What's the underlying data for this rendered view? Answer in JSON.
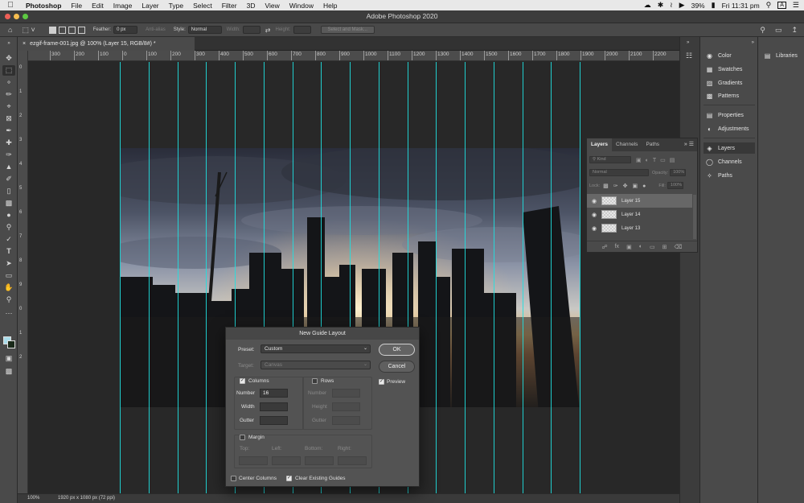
{
  "menubar": {
    "app_name": "Photoshop",
    "menus": [
      "File",
      "Edit",
      "Image",
      "Layer",
      "Type",
      "Select",
      "Filter",
      "3D",
      "View",
      "Window",
      "Help"
    ],
    "battery": "39%",
    "clock": "Fri 11:31 pm",
    "input_source": "A"
  },
  "window": {
    "title": "Adobe Photoshop 2020"
  },
  "options": {
    "feather_label": "Feather:",
    "feather_value": "0 px",
    "anti_alias": "Anti-alias",
    "style_label": "Style:",
    "style_value": "Normal",
    "width_label": "Width:",
    "height_label": "Height:",
    "select_mask": "Select and Mask..."
  },
  "document": {
    "tab_title": "ezgif-frame-001.jpg @ 100% (Layer 15, RGB/8#) *",
    "zoom": "100%",
    "dimensions": "1920 px x 1080 px (72 ppi)"
  },
  "ruler": {
    "h_labels": [
      "300",
      "200",
      "100",
      "0",
      "100",
      "200",
      "300",
      "400",
      "500",
      "600",
      "700",
      "800",
      "900",
      "1000",
      "1100",
      "1200",
      "1300",
      "1400",
      "1500",
      "1600",
      "1700",
      "1800",
      "1900",
      "2000",
      "2100",
      "2200"
    ],
    "v_labels": [
      "0",
      "1",
      "2",
      "3",
      "4",
      "5",
      "6",
      "7",
      "8",
      "9",
      "0",
      "1",
      "2"
    ]
  },
  "guides": {
    "count": 16
  },
  "panels": {
    "dock1": [
      {
        "label": "Color",
        "icon": "color-wheel-icon"
      },
      {
        "label": "Swatches",
        "icon": "grid-icon"
      },
      {
        "label": "Gradients",
        "icon": "gradient-icon"
      },
      {
        "label": "Patterns",
        "icon": "pattern-icon"
      },
      {
        "label": "Properties",
        "icon": "properties-icon"
      },
      {
        "label": "Adjustments",
        "icon": "adjustments-icon"
      },
      {
        "label": "Layers",
        "icon": "layers-icon"
      },
      {
        "label": "Channels",
        "icon": "channels-icon"
      },
      {
        "label": "Paths",
        "icon": "paths-icon"
      }
    ],
    "dock2": [
      {
        "label": "Libraries",
        "icon": "libraries-icon"
      }
    ]
  },
  "layers_panel": {
    "tabs": [
      "Layers",
      "Channels",
      "Paths"
    ],
    "kind": "Kind",
    "blend": "Normal",
    "opacity_label": "Opacity:",
    "opacity_value": "100%",
    "lock_label": "Lock:",
    "fill_label": "Fill:",
    "fill_value": "100%",
    "layers": [
      "Layer 15",
      "Layer 14",
      "Layer 13"
    ]
  },
  "dialog": {
    "title": "New Guide Layout",
    "preset_label": "Preset:",
    "preset_value": "Custom",
    "target_label": "Target:",
    "target_value": "Canvas",
    "columns_label": "Columns",
    "columns_checked": true,
    "rows_label": "Rows",
    "rows_checked": false,
    "number_label": "Number",
    "number_value": "16",
    "width_label": "Width",
    "gutter_label": "Gutter",
    "margin_label": "Margin",
    "margin_checked": false,
    "margin_top": "Top:",
    "margin_left": "Left:",
    "margin_bottom": "Bottom:",
    "margin_right": "Right:",
    "center_columns": "Center Columns",
    "center_columns_checked": false,
    "clear_guides": "Clear Existing Guides",
    "clear_guides_checked": true,
    "ok": "OK",
    "cancel": "Cancel",
    "preview": "Preview",
    "preview_checked": true
  }
}
